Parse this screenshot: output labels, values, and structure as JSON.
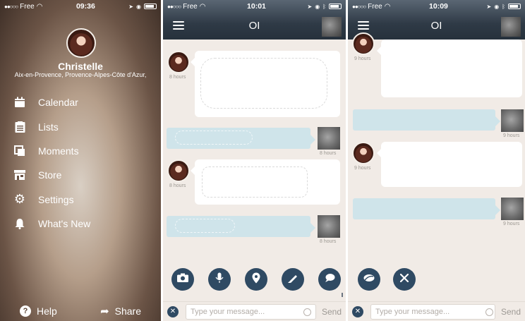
{
  "screens": {
    "menu": {
      "status": {
        "carrier": "Free",
        "time": "09:36"
      },
      "profile": {
        "name": "Christelle",
        "location": "Aix-en-Provence, Provence-Alpes-Côte d'Azur,"
      },
      "items": [
        {
          "label": "Calendar",
          "icon": "calendar-icon"
        },
        {
          "label": "Lists",
          "icon": "list-icon"
        },
        {
          "label": "Moments",
          "icon": "moments-icon"
        },
        {
          "label": "Store",
          "icon": "store-icon"
        },
        {
          "label": "Settings",
          "icon": "gear-icon"
        },
        {
          "label": "What's New",
          "icon": "bell-icon"
        }
      ],
      "footer": {
        "help": "Help",
        "share": "Share"
      }
    },
    "chat1": {
      "status": {
        "carrier": "Free",
        "time": "10:01"
      },
      "title": "OI",
      "messages": [
        {
          "direction": "in",
          "time": "8 hours"
        },
        {
          "direction": "out",
          "time": "8 hours"
        },
        {
          "direction": "in",
          "time": "8 hours"
        },
        {
          "direction": "out",
          "time": "8 hours"
        }
      ],
      "actions": [
        "camera-icon",
        "microphone-icon",
        "location-pin-icon",
        "pencil-icon",
        "chat-bubble-icon"
      ],
      "composer": {
        "placeholder": "Type your message...",
        "send": "Send"
      }
    },
    "chat2": {
      "status": {
        "carrier": "Free",
        "time": "10:09"
      },
      "title": "OI",
      "messages": [
        {
          "direction": "in",
          "time": "9 hours"
        },
        {
          "direction": "out",
          "time": "9 hours"
        },
        {
          "direction": "in",
          "time": "9 hours"
        },
        {
          "direction": "out",
          "time": "9 hours"
        }
      ],
      "actions": [
        "eraser-icon",
        "close-icon"
      ],
      "composer": {
        "placeholder": "Type your message...",
        "send": "Send"
      }
    }
  }
}
